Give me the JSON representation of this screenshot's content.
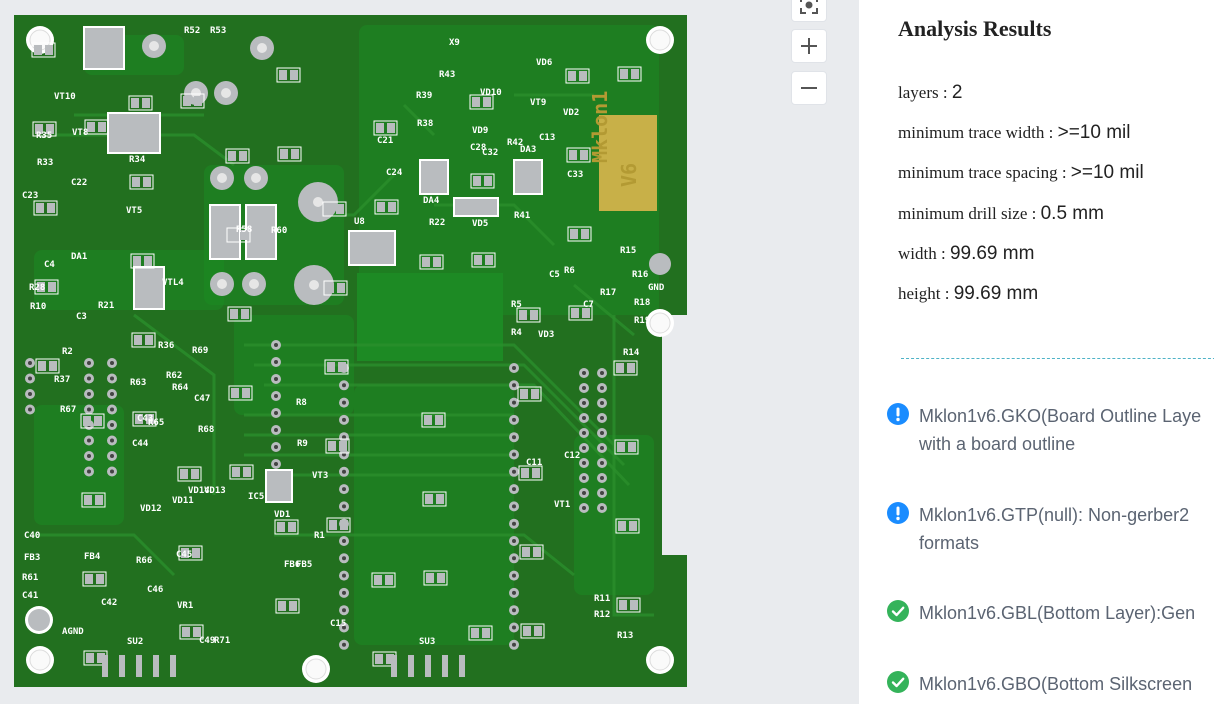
{
  "panel": {
    "title": "Analysis Results",
    "stats": [
      {
        "key": "layers : ",
        "value": "2"
      },
      {
        "key": "minimum trace width : ",
        "value": ">=10 mil"
      },
      {
        "key": "minimum trace spacing : ",
        "value": ">=10 mil"
      },
      {
        "key": "minimum drill size : ",
        "value": "0.5 mm"
      },
      {
        "key": "width : ",
        "value": "99.69 mm"
      },
      {
        "key": "height : ",
        "value": "99.69 mm"
      }
    ],
    "messages": [
      {
        "status": "info",
        "line1": "Mklon1v6.GKO(Board Outline Laye",
        "line2": "with a board outline"
      },
      {
        "status": "info",
        "line1": "Mklon1v6.GTP(null): Non-gerber2",
        "line2": "formats"
      },
      {
        "status": "ok",
        "line1": "Mklon1v6.GBL(Bottom Layer):Gen",
        "line2": ""
      },
      {
        "status": "ok",
        "line1": "Mklon1v6.GBO(Bottom Silkscreen",
        "line2": ""
      }
    ]
  },
  "board": {
    "silk_labels": [
      "R52",
      "R53",
      "X9",
      "VD6",
      "R43",
      "VD10",
      "VT9",
      "VD2",
      "VT10",
      "VT8",
      "R35",
      "R33",
      "R34",
      "C22",
      "C23",
      "VT5",
      "R39",
      "R38",
      "C21",
      "VD9",
      "R42",
      "C13",
      "C28",
      "C32",
      "DA3",
      "C24",
      "DA4",
      "R22",
      "VD5",
      "R41",
      "C33",
      "R58",
      "R60",
      "U8",
      "DA1",
      "C4",
      "R28",
      "R10",
      "R21",
      "C3",
      "VTL4",
      "R15",
      "R16",
      "C5",
      "R6",
      "GND",
      "R17",
      "R18",
      "R19",
      "R5",
      "C7",
      "R4",
      "VD3",
      "R14",
      "R2",
      "R37",
      "R67",
      "R36",
      "R63",
      "R69",
      "R62",
      "R64",
      "C43",
      "C47",
      "R65",
      "R68",
      "C44",
      "R8",
      "R9",
      "VD14",
      "VD13",
      "VD11",
      "VD12",
      "IC5",
      "VT3",
      "VD1",
      "R1",
      "C11",
      "C12",
      "VT1",
      "C40",
      "FB3",
      "R61",
      "C41",
      "AGND",
      "FB4",
      "R66",
      "C46",
      "C42",
      "C45",
      "VR1",
      "FB6",
      "FB5",
      "C15",
      "R11",
      "R12",
      "R13",
      "SU2",
      "C49",
      "R71",
      "SU3",
      "Mklon1",
      "V6"
    ],
    "colors": {
      "mask": "#22701f",
      "copper": "#1c8a23",
      "pad": "#b9bcbf",
      "silk": "#ffffff",
      "gold": "#c8b048"
    }
  },
  "viewer": {
    "icons": [
      "fit-icon",
      "zoom-in-icon",
      "zoom-out-icon"
    ]
  }
}
